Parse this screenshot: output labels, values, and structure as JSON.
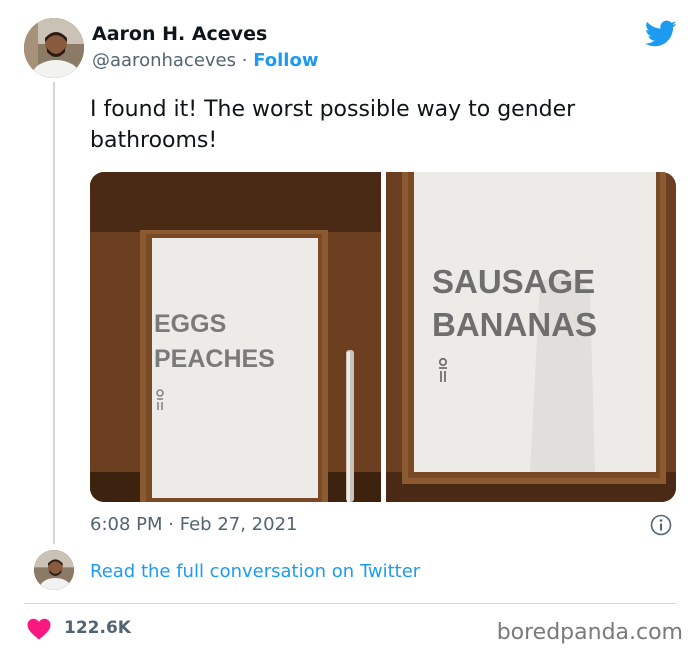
{
  "tweet": {
    "author_name": "Aaron H. Aceves",
    "handle": "@aaronhaceves",
    "separator": "·",
    "follow_label": "Follow",
    "text": "I found it! The worst possible way to gender bathrooms!",
    "time": "6:08 PM",
    "date": "Feb 27, 2021"
  },
  "media": {
    "left_sign_line1": "EGGS",
    "left_sign_line2": "PEACHES",
    "right_sign_line1": "SAUSAGE",
    "right_sign_line2": "BANANAS"
  },
  "conversation": {
    "link_label": "Read the full conversation on Twitter"
  },
  "engagement": {
    "likes": "122.6K"
  },
  "watermark": "boredpanda.com",
  "colors": {
    "accent": "#1d9bf0",
    "heart": "#f91880",
    "text_secondary": "#536471"
  },
  "icons": [
    "twitter-bird-icon",
    "info-icon",
    "heart-icon",
    "female-symbol-icon",
    "male-symbol-icon"
  ]
}
